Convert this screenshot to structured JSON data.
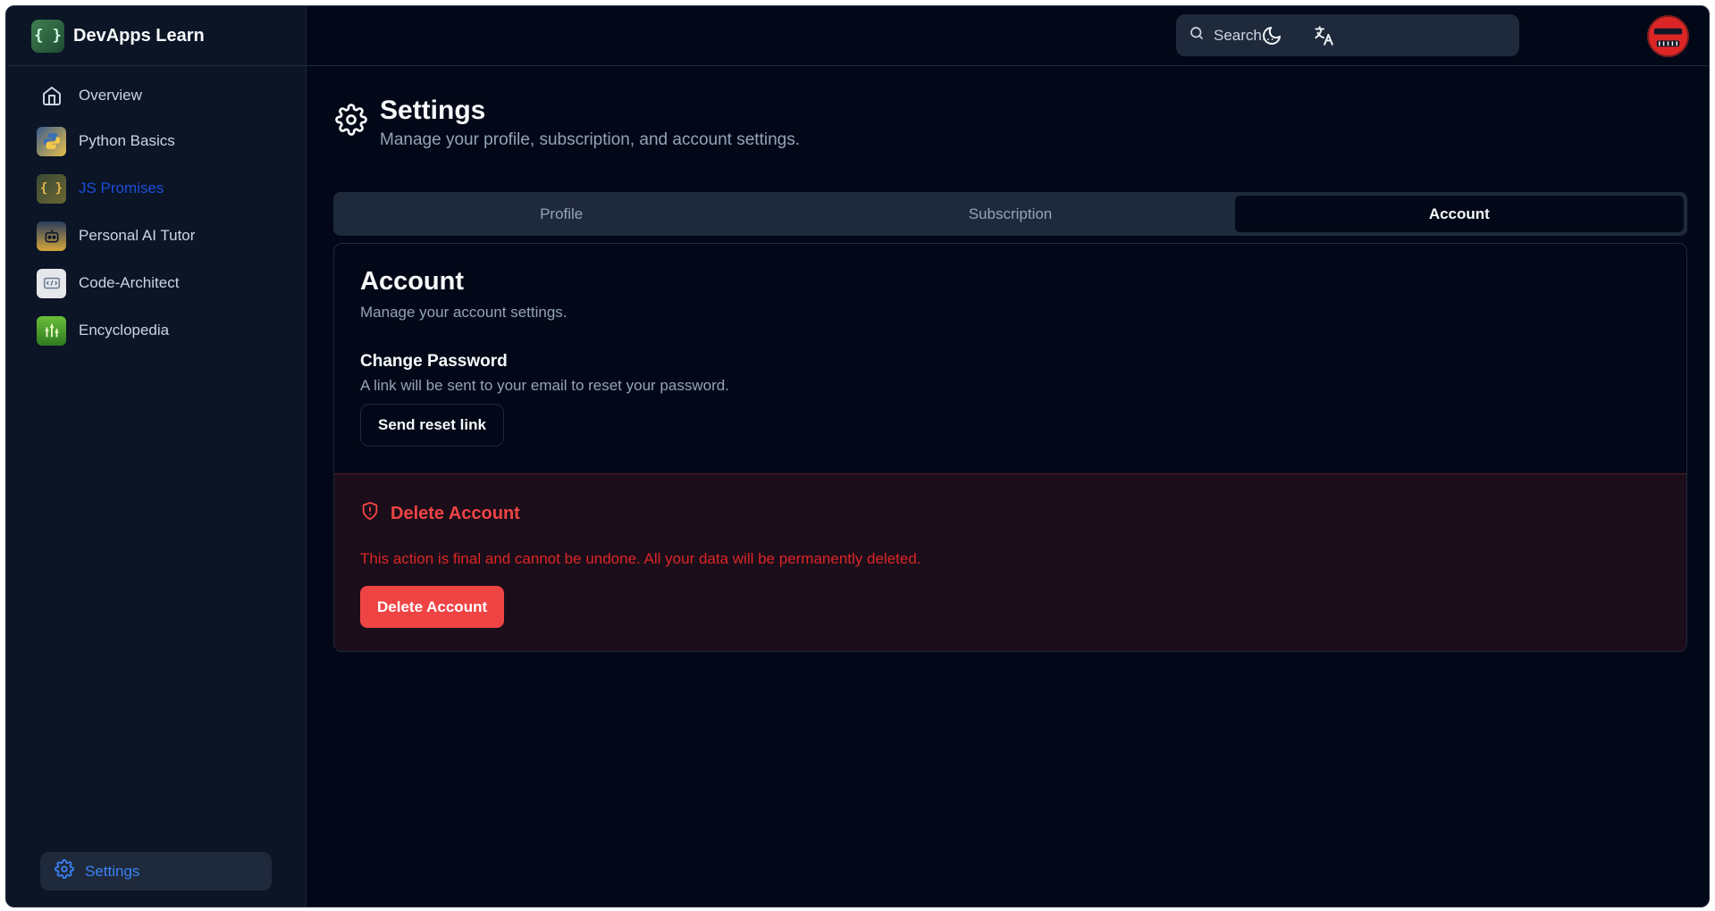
{
  "app": {
    "name": "DevApps Learn",
    "logo_text": "{ }"
  },
  "sidebar": {
    "items": [
      {
        "label": "Overview",
        "icon": "home-icon"
      },
      {
        "label": "Python Basics",
        "icon": "python-app-icon"
      },
      {
        "label": "JS Promises",
        "icon": "js-app-icon",
        "active": true
      },
      {
        "label": "Personal AI Tutor",
        "icon": "robot-app-icon"
      },
      {
        "label": "Code-Architect",
        "icon": "architect-app-icon"
      },
      {
        "label": "Encyclopedia",
        "icon": "encyclopedia-app-icon"
      }
    ],
    "settings_label": "Settings"
  },
  "topbar": {
    "search_placeholder": "Search...",
    "icons": [
      "moon-icon",
      "translate-icon"
    ]
  },
  "page": {
    "title": "Settings",
    "subtitle": "Manage your profile, subscription, and account settings."
  },
  "tabs": [
    {
      "label": "Profile"
    },
    {
      "label": "Subscription"
    },
    {
      "label": "Account",
      "active": true
    }
  ],
  "account": {
    "title": "Account",
    "subtitle": "Manage your account settings.",
    "change_password": {
      "title": "Change Password",
      "description": "A link will be sent to your email to reset your password.",
      "button": "Send reset link"
    },
    "delete": {
      "title": "Delete Account",
      "description": "This action is final and cannot be undone. All your data will be permanently deleted.",
      "button": "Delete Account"
    }
  },
  "colors": {
    "background": "#020817",
    "sidebar": "#0b1526",
    "accent": "#3b82f6",
    "danger": "#ef4444"
  }
}
